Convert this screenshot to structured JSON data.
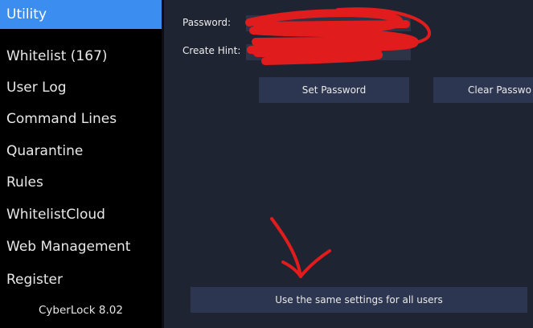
{
  "sidebar": {
    "items": [
      {
        "label": "Utility",
        "active": true
      },
      {
        "label": "Whitelist (167)",
        "active": false
      },
      {
        "label": "User Log",
        "active": false
      },
      {
        "label": "Command Lines",
        "active": false
      },
      {
        "label": "Quarantine",
        "active": false
      },
      {
        "label": "Rules",
        "active": false
      },
      {
        "label": "WhitelistCloud",
        "active": false
      },
      {
        "label": "Web Management",
        "active": false
      },
      {
        "label": "Register",
        "active": false
      }
    ],
    "version": "CyberLock 8.02"
  },
  "main": {
    "password_label": "Password:",
    "hint_label": "Create Hint:",
    "password_value": "",
    "hint_value": "",
    "set_password_button": "Set Password",
    "clear_password_button": "Clear Passwo",
    "same_settings_button": "Use the same settings for all users"
  },
  "colors": {
    "accent": "#3b8ef0",
    "background": "#1f2433",
    "sidebar": "#000000",
    "button": "#2d3650",
    "annotation": "#e01c1c"
  }
}
